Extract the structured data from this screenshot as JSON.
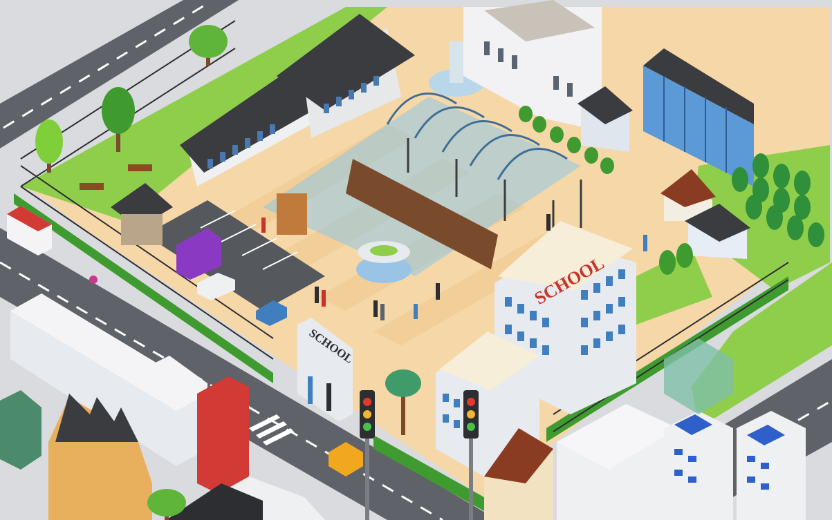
{
  "scene": {
    "description_label": "",
    "signs": {
      "building_sign": "SCHOOL",
      "gate_sign": "SCHOOL"
    }
  },
  "colors": {
    "road": "#5a5d63",
    "plaza": "#f6d7a8",
    "grass": "#8fce4a",
    "sign_red": "#c8342c",
    "building_blue": "#3f7fc0",
    "roof_dark": "#3a3c40"
  }
}
